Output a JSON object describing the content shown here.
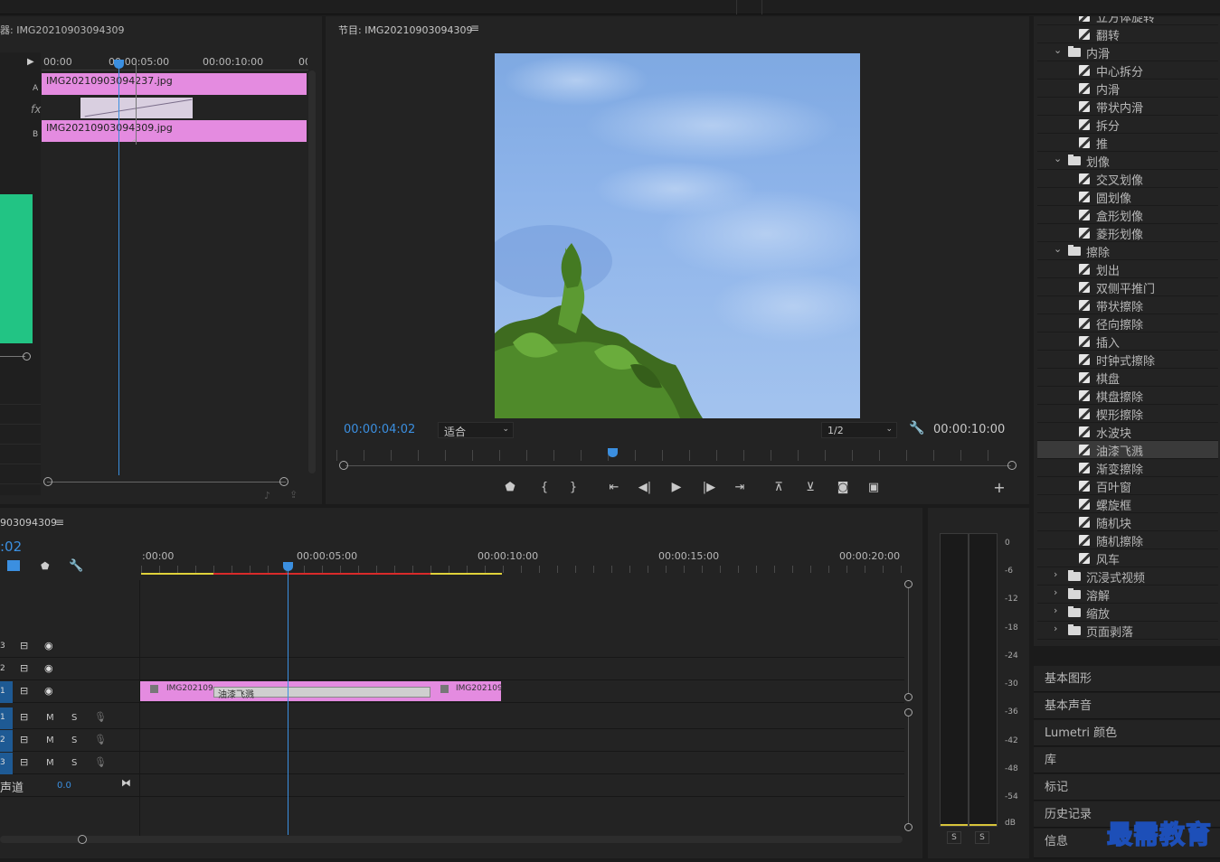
{
  "source_monitor": {
    "title": "器: IMG20210903094309",
    "ruler": [
      "00:00",
      "00:00:05:00",
      "00:00:10:00",
      "00:"
    ],
    "track_a": "A",
    "track_b": "B",
    "fx_label": "fx",
    "clip_a": "IMG20210903094237.jpg",
    "clip_b": "IMG20210903094309.jpg"
  },
  "program_monitor": {
    "title": "节目: IMG20210903094309",
    "timecode_current": "00:00:04:02",
    "fit_select": "适合",
    "resolution_select": "1/2",
    "timecode_duration": "00:00:10:00"
  },
  "timeline": {
    "title": "903094309",
    "timecode": ":02",
    "ruler": [
      ":00:00",
      "00:00:05:00",
      "00:00:10:00",
      "00:00:15:00",
      "00:00:20:00"
    ],
    "video_tracks": [
      "3",
      "2",
      "1"
    ],
    "audio_tracks": [
      "1",
      "2",
      "3"
    ],
    "m_label": "M",
    "s_label": "S",
    "master_label": "声道",
    "master_value": "0.0",
    "clip_left": "IMG202109",
    "transition": "油漆飞溅",
    "clip_right": "IMG202109"
  },
  "audio_meter": {
    "scale": [
      "0",
      "-6",
      "-12",
      "-18",
      "-24",
      "-30",
      "-36",
      "-42",
      "-48",
      "-54",
      "dB"
    ],
    "solo_left": "S",
    "solo_right": "S"
  },
  "effects_tree": [
    {
      "type": "fx",
      "label": "立方体旋转"
    },
    {
      "type": "fx",
      "label": "翻转"
    },
    {
      "type": "folder",
      "label": "内滑",
      "open": true
    },
    {
      "type": "fx",
      "label": "中心拆分"
    },
    {
      "type": "fx",
      "label": "内滑"
    },
    {
      "type": "fx",
      "label": "带状内滑"
    },
    {
      "type": "fx",
      "label": "拆分"
    },
    {
      "type": "fx",
      "label": "推"
    },
    {
      "type": "folder",
      "label": "划像",
      "open": true
    },
    {
      "type": "fx",
      "label": "交叉划像"
    },
    {
      "type": "fx",
      "label": "圆划像"
    },
    {
      "type": "fx",
      "label": "盒形划像"
    },
    {
      "type": "fx",
      "label": "菱形划像"
    },
    {
      "type": "folder",
      "label": "擦除",
      "open": true
    },
    {
      "type": "fx",
      "label": "划出"
    },
    {
      "type": "fx",
      "label": "双侧平推门"
    },
    {
      "type": "fx",
      "label": "带状擦除"
    },
    {
      "type": "fx",
      "label": "径向擦除"
    },
    {
      "type": "fx",
      "label": "插入"
    },
    {
      "type": "fx",
      "label": "时钟式擦除"
    },
    {
      "type": "fx",
      "label": "棋盘"
    },
    {
      "type": "fx",
      "label": "棋盘擦除"
    },
    {
      "type": "fx",
      "label": "楔形擦除"
    },
    {
      "type": "fx",
      "label": "水波块"
    },
    {
      "type": "fx",
      "label": "油漆飞溅",
      "selected": true
    },
    {
      "type": "fx",
      "label": "渐变擦除"
    },
    {
      "type": "fx",
      "label": "百叶窗"
    },
    {
      "type": "fx",
      "label": "螺旋框"
    },
    {
      "type": "fx",
      "label": "随机块"
    },
    {
      "type": "fx",
      "label": "随机擦除"
    },
    {
      "type": "fx",
      "label": "风车"
    },
    {
      "type": "folder",
      "label": "沉浸式视频",
      "open": false
    },
    {
      "type": "folder",
      "label": "溶解",
      "open": false
    },
    {
      "type": "folder",
      "label": "缩放",
      "open": false
    },
    {
      "type": "folder",
      "label": "页面剥落",
      "open": false
    }
  ],
  "side_panels": [
    "基本图形",
    "基本声音",
    "Lumetri 颜色",
    "库",
    "标记",
    "历史记录",
    "信息"
  ],
  "watermark": "最需教育"
}
